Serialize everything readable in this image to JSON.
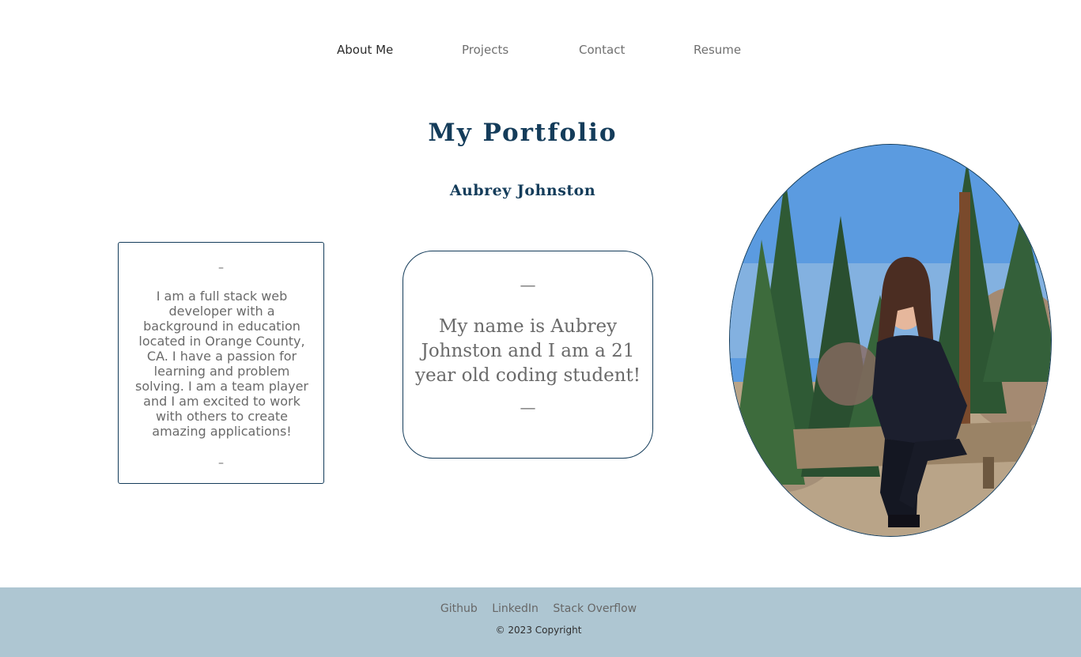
{
  "nav": {
    "items": [
      {
        "label": "About Me",
        "active": true
      },
      {
        "label": "Projects",
        "active": false
      },
      {
        "label": "Contact",
        "active": false
      },
      {
        "label": "Resume",
        "active": false
      }
    ]
  },
  "header": {
    "title": "My Portfolio",
    "subtitle": "Aubrey Johnston"
  },
  "about_card": {
    "dash_top": "–",
    "text": "I am a full stack web developer with a background in education located in Orange County, CA. I have a passion for learning and problem solving. I am a team player and I am excited to work with others to create amazing applications!",
    "dash_bottom": "–"
  },
  "intro_card": {
    "dash_top": "—",
    "text": "My name is Aubrey Johnston and I am a 21 year old coding student!",
    "dash_bottom": "—"
  },
  "footer": {
    "links": [
      "Github",
      "LinkedIn",
      "Stack Overflow"
    ],
    "copyright": "© 2023 Copyright"
  },
  "colors": {
    "accent": "#143c5a",
    "footer_bg": "#aec6d2",
    "text_muted": "#6a6a6a"
  }
}
